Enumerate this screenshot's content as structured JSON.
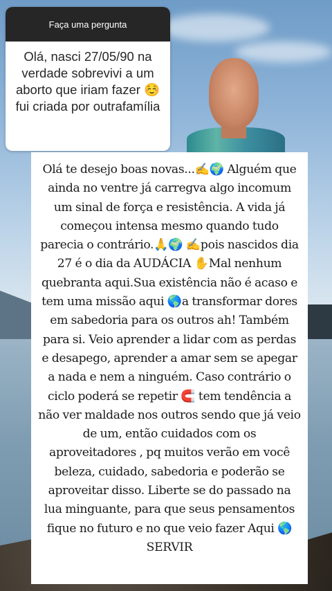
{
  "question_card": {
    "header_label": "Faça uma pergunta",
    "question_text": "Olá, nasci 27/05/90 na verdade sobrevivi a um aborto que iriam fazer ☺️ fui criada por outrafamília"
  },
  "profile_photo": {
    "description_icon": "profile-photo-icon"
  },
  "reply": {
    "text": "Olá te desejo boas novas...✍️🌍 Alguém que ainda no ventre já carregva algo incomum um sinal de força e resistência. A vida já começou intensa mesmo quando tudo parecia o contrário.🙏🌍 ✍️pois nascidos dia 27 é o dia da AUDÁCIA ✋Mal nenhum quebranta aqui.Sua existência não é acaso e tem uma missão aqui 🌎a transformar dores em sabedoria para os outros ah! Também para si. Veio aprender a lidar com as perdas e desapego, aprender a amar sem se apegar a nada e nem a ninguém. Caso contrário o ciclo poderá se repetir 🧲 tem tendência a não ver maldade nos outros sendo que já veio de um, então cuidados com os aproveitadores , pq muitos verão em você beleza, cuidado, sabedoria e poderão se aproveitar disso. Liberte se do passado na lua minguante, para que seus pensamentos fique no futuro e no que veio fazer Aqui 🌎 SERVIR"
  },
  "colors": {
    "card_header_bg": "#262626",
    "card_bg": "#ffffff",
    "reply_bg": "#ffffff",
    "text": "#1a1a1a"
  }
}
